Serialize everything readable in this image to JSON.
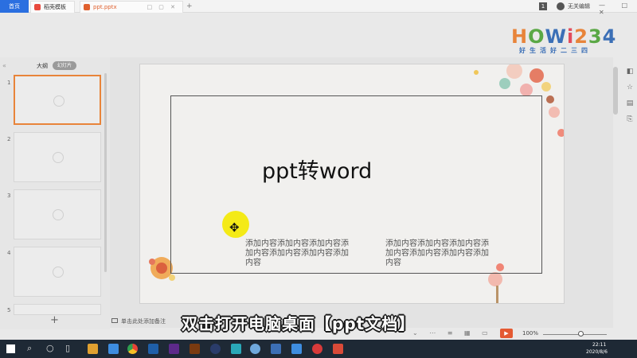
{
  "tabbar": {
    "home": "首页",
    "templates_tab": "稻壳模板",
    "file_tab": "ppt.pptx",
    "file_tab_tools": "□ ▢ ✕",
    "add_tab": "+",
    "badge": "1",
    "user_name": "无关编辑",
    "window_controls": "— □ ✕"
  },
  "watermark": {
    "logo_text": "HOWi234",
    "slogan": "好生活好二三四",
    "colors": [
      "#e8843a",
      "#3b6fb6",
      "#5aa845",
      "#e24c5c"
    ]
  },
  "left_panel": {
    "collapse": "«",
    "outline_tab": "大纲",
    "slides_tab": "幻灯片",
    "add_slide": "+",
    "slides": [
      {
        "num": "1",
        "active": true
      },
      {
        "num": "2",
        "active": false
      },
      {
        "num": "3",
        "active": false
      },
      {
        "num": "4",
        "active": false
      },
      {
        "num": "5",
        "active": false
      }
    ]
  },
  "slide": {
    "title": "ppt转word",
    "left_column": "添加内容添加内容添加内容添加内容添加内容添加内容添加内容",
    "right_column": "添加内容添加内容添加内容添加内容添加内容添加内容添加内容"
  },
  "right_tools": [
    "◧",
    "☆",
    "▤",
    "⎘"
  ],
  "notes": {
    "placeholder": "单击此处添加备注"
  },
  "caption": "双击打开电脑桌面【ppt文档】",
  "status": {
    "nav": "⌄ ⋯ ≡ ▦ ▭",
    "play": "▶",
    "zoom": "100%"
  },
  "taskbar": {
    "time": "22:11",
    "date": "2020/8/6",
    "apps": [
      "search",
      "task-view",
      "chrome",
      "photoshop",
      "premiere",
      "illustrator",
      "cinema4d",
      "app",
      "app",
      "app",
      "app",
      "record",
      "wps"
    ]
  },
  "colors": {
    "accent_orange": "#e8843a",
    "home_blue": "#2b6fe0",
    "cursor_yellow": "#f4ea17"
  }
}
